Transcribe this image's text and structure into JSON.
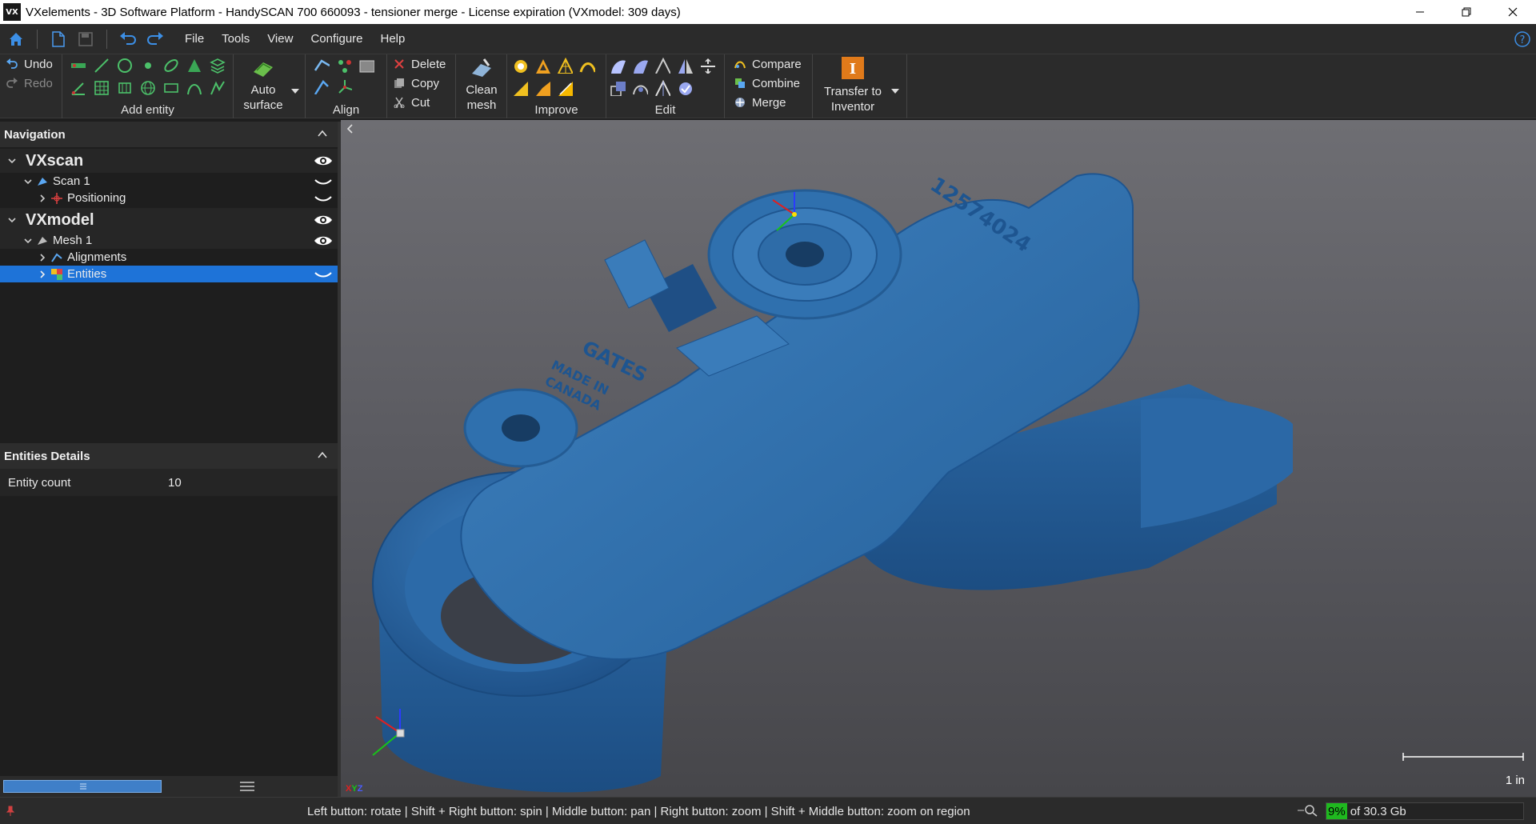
{
  "window": {
    "logo_text": "VX",
    "title": "VXelements - 3D Software Platform - HandySCAN 700 660093 - tensioner merge - License expiration (VXmodel: 309 days)",
    "controls": [
      "minimize-icon",
      "restore-icon",
      "close-icon"
    ]
  },
  "menu": {
    "items": [
      "File",
      "Tools",
      "View",
      "Configure",
      "Help"
    ]
  },
  "ribbon": {
    "undo": "Undo",
    "redo": "Redo",
    "add_entity": "Add entity",
    "auto_surface_1": "Auto",
    "auto_surface_2": "surface",
    "align": "Align",
    "delete": "Delete",
    "copy": "Copy",
    "cut": "Cut",
    "clean_mesh_1": "Clean",
    "clean_mesh_2": "mesh",
    "improve": "Improve",
    "edit": "Edit",
    "compare": "Compare",
    "combine": "Combine",
    "merge": "Merge",
    "transfer_1": "Transfer to",
    "transfer_2": "Inventor"
  },
  "navigation": {
    "header": "Navigation",
    "tree": [
      {
        "label": "VXscan",
        "level": 0
      },
      {
        "label": "Scan 1",
        "level": 1
      },
      {
        "label": "Positioning",
        "level": 2
      },
      {
        "label": "VXmodel",
        "level": 0
      },
      {
        "label": "Mesh 1",
        "level": 1
      },
      {
        "label": "Alignments",
        "level": 2
      },
      {
        "label": "Entities",
        "level": 2,
        "selected": true
      }
    ]
  },
  "details": {
    "header": "Entities Details",
    "rows": [
      {
        "key": "Entity count",
        "value": "10"
      }
    ]
  },
  "viewport": {
    "part_text_1": "12574024",
    "part_text_2": "GATES",
    "part_text_3": "MADE IN",
    "part_text_4": "CANADA",
    "scale_label": "1 in",
    "axis_labels": [
      "X",
      "Y",
      "Z"
    ]
  },
  "status": {
    "hint": "Left button: rotate  |  Shift + Right button: spin  |  Middle button: pan  |  Right button: zoom  |  Shift + Middle button: zoom on region",
    "mem_pct": "9%",
    "mem_rest": "of 30.3 Gb"
  },
  "colors": {
    "accent": "#1e73d8",
    "mesh": "#2f6faa",
    "memory_ok": "#1fb81f"
  }
}
